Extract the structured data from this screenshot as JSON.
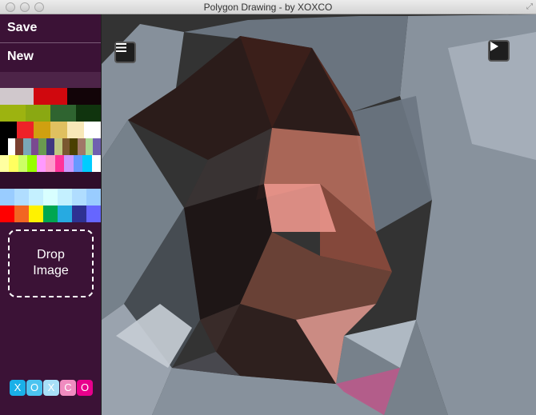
{
  "window": {
    "title": "Polygon Drawing - by XOXCO"
  },
  "sidebar": {
    "save_label": "Save",
    "new_label": "New",
    "drop_label_line1": "Drop",
    "drop_label_line2": "Image",
    "palette_rows": [
      [
        "#d0c8cc",
        "#d0080e",
        "#120408"
      ],
      [
        "#9db310",
        "#8aa812",
        "#2f6430",
        "#10340e"
      ],
      [
        "#000000",
        "#ee2228",
        "#d0a010",
        "#e0c060",
        "#f8e8b8",
        "#ffffff"
      ],
      [
        "#000000",
        "#ffffff",
        "#7a4030",
        "#7aa8b8",
        "#7a4a90",
        "#6a9a50",
        "#403880",
        "#c0c880",
        "#7a5830",
        "#4a4000",
        "#a07868",
        "#a8d890",
        "#7060b0"
      ],
      [
        "#ffffa0",
        "#ffff60",
        "#ccff66",
        "#99ff00",
        "#ff99ff",
        "#ff99cc",
        "#ff3399",
        "#cc99ff",
        "#6699ff",
        "#00ccff",
        "#ffffff"
      ],
      [
        "#99ccff",
        "#b0ddff",
        "#c4f0ff",
        "#d8ffff",
        "#c4f0ff",
        "#b0ddff",
        "#99ccff"
      ],
      [
        "#ff0000",
        "#f26522",
        "#fff200",
        "#00a651",
        "#27aae1",
        "#2e3192",
        "#6666ff"
      ]
    ],
    "logo": {
      "letters": [
        "X",
        "O",
        "X",
        "C",
        "O"
      ],
      "colors": [
        "#1ab0e8",
        "#4cc4f0",
        "#a8e0f8",
        "#f08cc0",
        "#e8008c"
      ]
    }
  },
  "canvas": {
    "menu_icon": "hamburger-icon",
    "play_icon": "play-icon"
  }
}
